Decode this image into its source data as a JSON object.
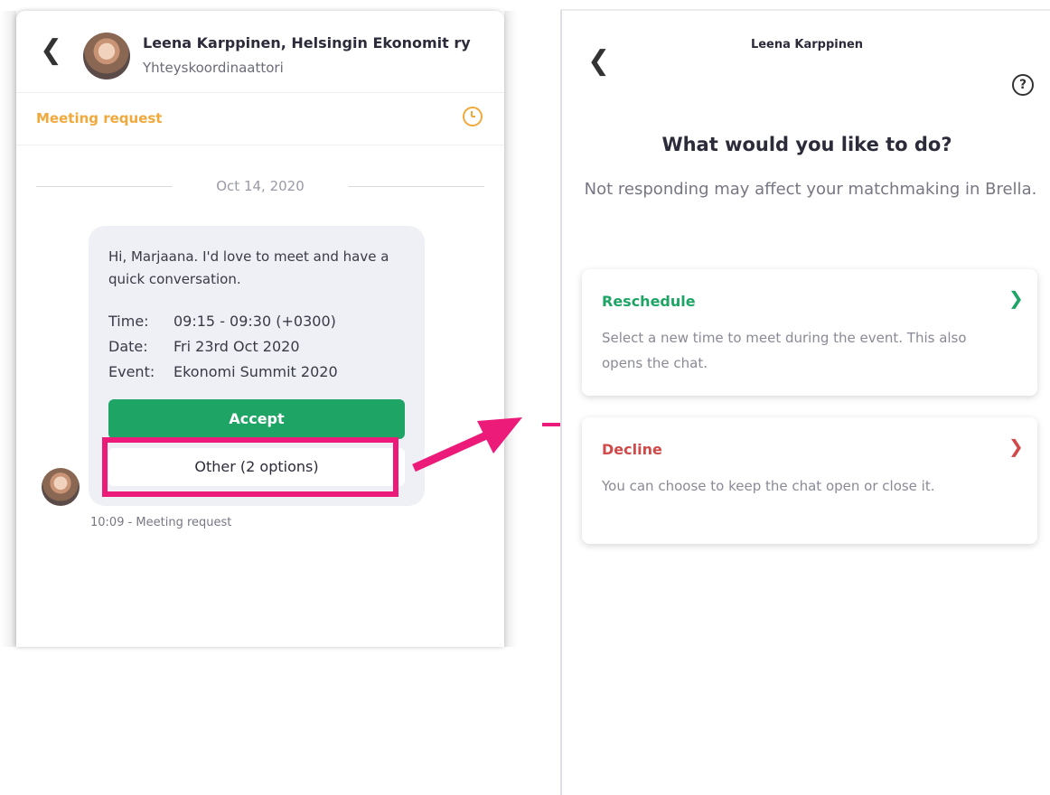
{
  "left": {
    "header": {
      "name": "Leena Karppinen, Helsingin Ekonomit ry",
      "role": "Yhteyskoordinaattori"
    },
    "meeting_bar": {
      "label": "Meeting request"
    },
    "date": "Oct 14, 2020",
    "message": {
      "text": "Hi, Marjaana. I'd love to meet and have a quick conversation.",
      "details": [
        {
          "label": "Time:",
          "value": "09:15 - 09:30 (+0300)"
        },
        {
          "label": "Date:",
          "value": "Fri 23rd Oct 2020"
        },
        {
          "label": "Event:",
          "value": "Ekonomi Summit 2020"
        }
      ],
      "accept_label": "Accept",
      "other_label": "Other (2 options)",
      "timestamp": "10:09 - Meeting request"
    }
  },
  "right": {
    "title": "Leena Karppinen",
    "heading": "What would you like to do?",
    "subheading": "Not responding may affect your matchmaking in Brella.",
    "options": [
      {
        "title": "Reschedule",
        "description": "Select a new time to meet during the event. This also opens the chat."
      },
      {
        "title": "Decline",
        "description": "You can choose to keep the chat open or close it."
      }
    ]
  },
  "colors": {
    "accent_green": "#1ea565",
    "decline_red": "#d04a4a",
    "meeting_orange": "#f2a93b",
    "annotation_pink": "#ec1a79"
  }
}
